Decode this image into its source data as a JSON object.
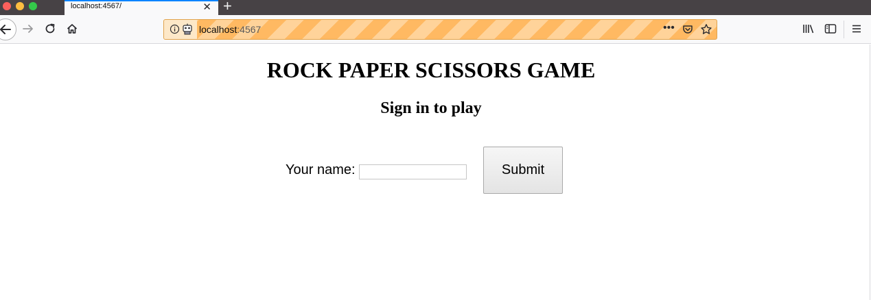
{
  "browser": {
    "tab_title": "localhost:4567/",
    "tab_close_icon": "close-icon",
    "new_tab_label": "+",
    "url_host": "localhost",
    "url_port": ":4567",
    "more_label": "•••",
    "accent_color": "#0a84ff",
    "urlbar_stripe_colors": [
      "#ffb962",
      "#ffd39a"
    ]
  },
  "page": {
    "title": "ROCK PAPER SCISSORS GAME",
    "subtitle": "Sign in to play",
    "form": {
      "name_label": "Your name:",
      "name_value": "",
      "submit_label": "Submit"
    }
  }
}
